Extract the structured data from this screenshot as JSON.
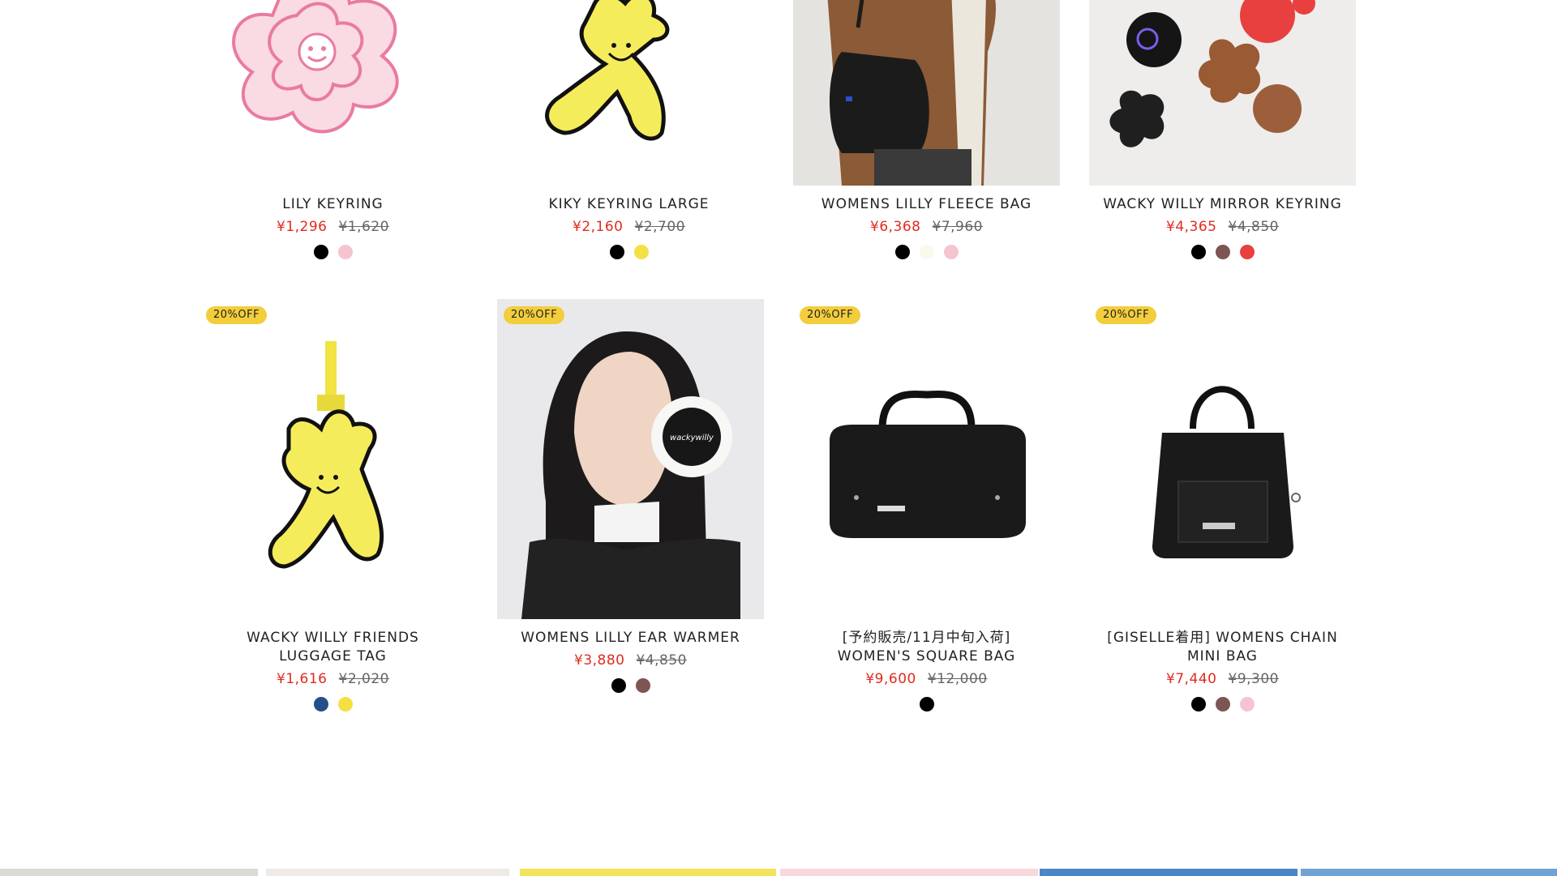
{
  "badge_text": "20%OFF",
  "products_row1": [
    {
      "name_lines": [
        "LILY KEYRING"
      ],
      "sale": "¥1,296",
      "orig": "¥1,620",
      "swatches": [
        "#000000",
        "#f6c4d0"
      ],
      "image": "pink-flower-keyring"
    },
    {
      "name_lines": [
        "KIKY KEYRING LARGE"
      ],
      "sale": "¥2,160",
      "orig": "¥2,700",
      "swatches": [
        "#000000",
        "#f5e044"
      ],
      "image": "yellow-character-keyring"
    },
    {
      "name_lines": [
        "WOMENS LILLY FLEECE BAG"
      ],
      "sale": "¥6,368",
      "orig": "¥7,960",
      "swatches": [
        "#000000",
        "#fbf8ec",
        "#f6c4d0"
      ],
      "image": "person-brown-fleece-with-black-bag"
    },
    {
      "name_lines": [
        "WACKY WILLY MIRROR KEYRING"
      ],
      "sale": "¥4,365",
      "orig": "¥4,850",
      "swatches": [
        "#000000",
        "#7d5553",
        "#e8403e"
      ],
      "image": "mirror-keyrings-flatlay"
    }
  ],
  "products_row2": [
    {
      "name_lines": [
        "WACKY WILLY FRIENDS",
        "LUGGAGE TAG"
      ],
      "sale": "¥1,616",
      "orig": "¥2,020",
      "swatches": [
        "#244f8a",
        "#f5e044"
      ],
      "image": "yellow-luggage-tag"
    },
    {
      "name_lines": [
        "WOMENS LILLY EAR WARMER"
      ],
      "sale": "¥3,880",
      "orig": "¥4,850",
      "swatches": [
        "#000000",
        "#7d5553"
      ],
      "image": "model-wearing-ear-warmer"
    },
    {
      "name_lines": [
        "[予約販売/11月中旬入荷]",
        "WOMEN'S SQUARE BAG"
      ],
      "sale": "¥9,600",
      "orig": "¥12,000",
      "swatches": [
        "#000000"
      ],
      "image": "black-square-bag"
    },
    {
      "name_lines": [
        "[GISELLE着用] WOMENS CHAIN",
        "MINI BAG"
      ],
      "sale": "¥7,440",
      "orig": "¥9,300",
      "swatches": [
        "#000000",
        "#7d5553",
        "#f6c4d0"
      ],
      "image": "black-chain-mini-bag"
    }
  ],
  "colors": {
    "sale": "#e02b20",
    "badge": "#f3cd3b"
  }
}
